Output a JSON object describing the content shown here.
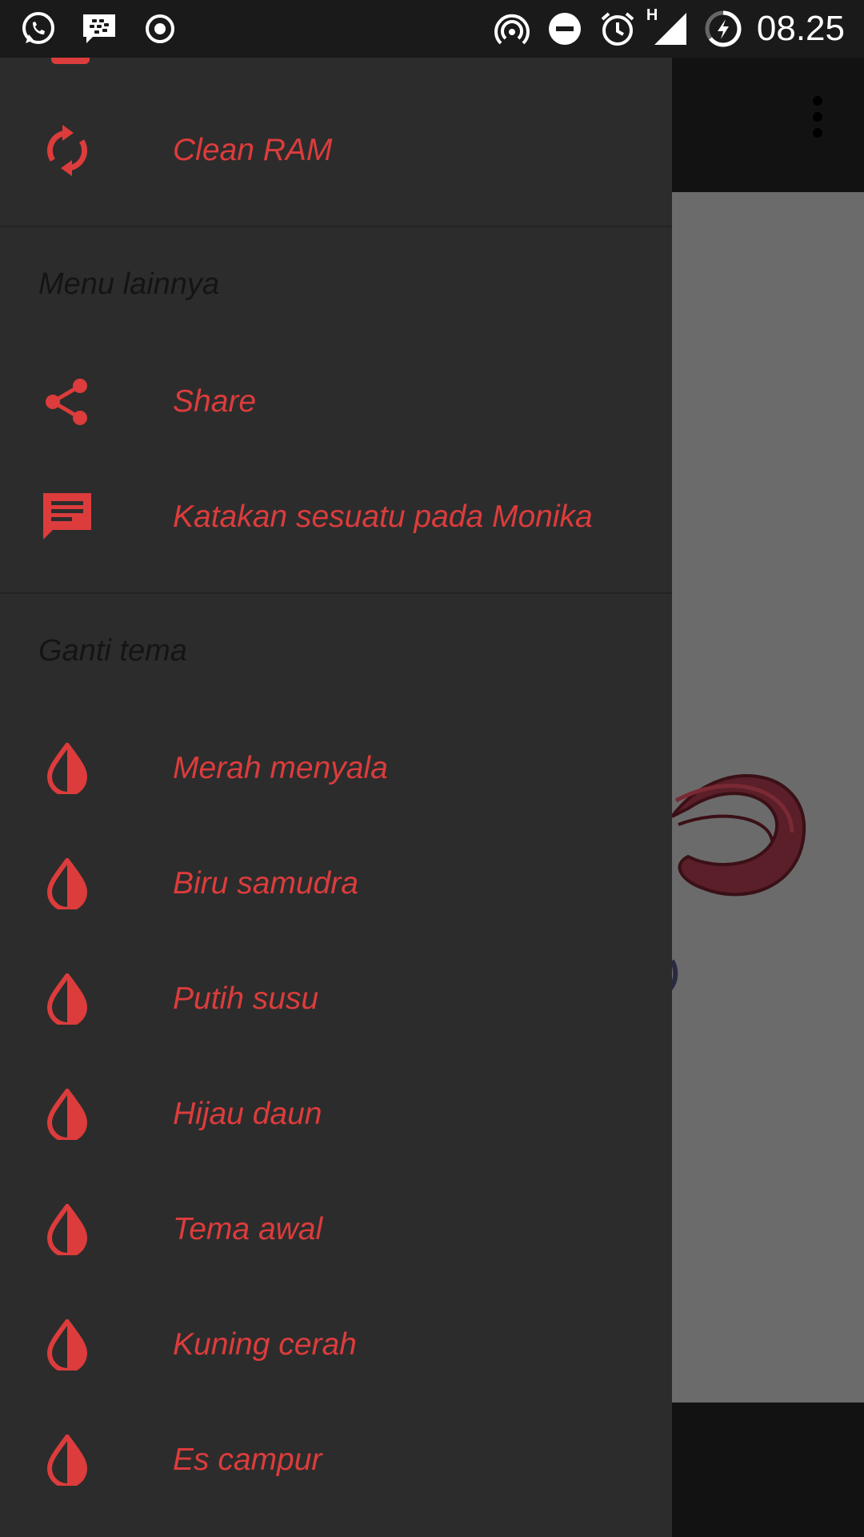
{
  "status_bar": {
    "time": "08.25",
    "left_icons": [
      "whatsapp-icon",
      "bbm-icon",
      "record-icon"
    ],
    "right_icons": [
      "hotspot-icon",
      "do-not-disturb-icon",
      "alarm-icon",
      "signal-icon",
      "battery-charging-icon"
    ],
    "network_label": "H"
  },
  "drawer": {
    "accent_color": "#dc3c3c",
    "background_color": "#2c2c2c",
    "items_top": [
      {
        "label": "Clean RAM",
        "icon": "refresh-icon"
      }
    ],
    "section_more": {
      "header": "Menu lainnya",
      "items": [
        {
          "label": "Share",
          "icon": "share-icon"
        },
        {
          "label": "Katakan sesuatu pada Monika",
          "icon": "message-icon"
        }
      ]
    },
    "section_theme": {
      "header": "Ganti tema",
      "items": [
        {
          "label": "Merah menyala",
          "icon": "droplet-icon"
        },
        {
          "label": "Biru samudra",
          "icon": "droplet-icon"
        },
        {
          "label": "Putih susu",
          "icon": "droplet-icon"
        },
        {
          "label": "Hijau daun",
          "icon": "droplet-icon"
        },
        {
          "label": "Tema awal",
          "icon": "droplet-icon"
        },
        {
          "label": "Kuning cerah",
          "icon": "droplet-icon"
        },
        {
          "label": "Es campur",
          "icon": "droplet-icon"
        }
      ]
    }
  }
}
